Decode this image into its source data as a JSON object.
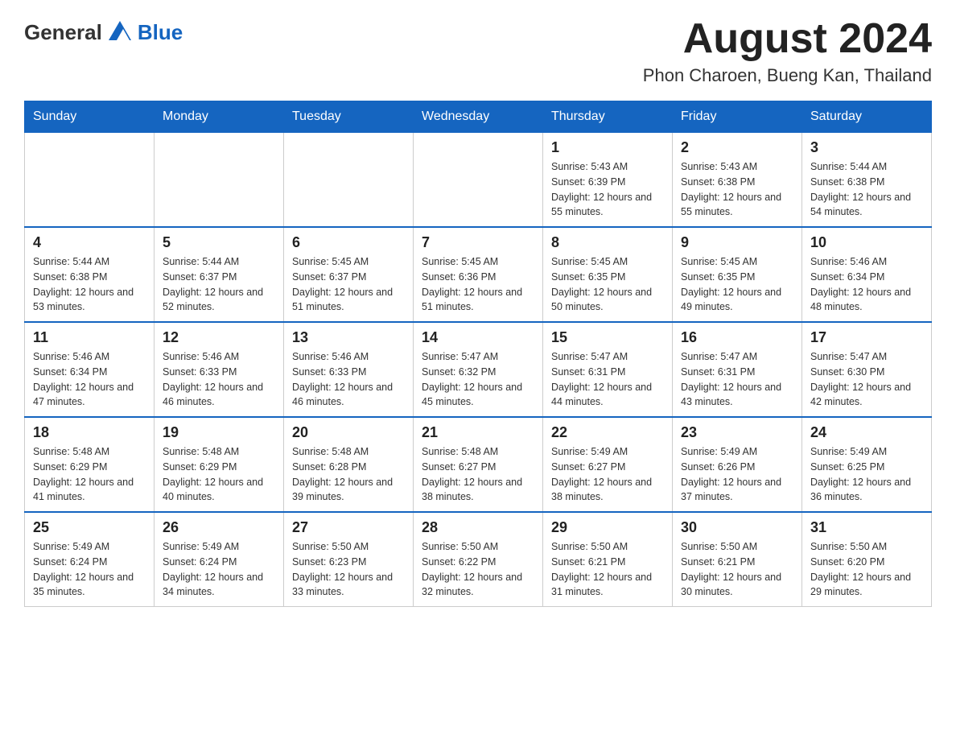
{
  "header": {
    "logo_general": "General",
    "logo_blue": "Blue",
    "month_title": "August 2024",
    "location": "Phon Charoen, Bueng Kan, Thailand"
  },
  "weekdays": [
    "Sunday",
    "Monday",
    "Tuesday",
    "Wednesday",
    "Thursday",
    "Friday",
    "Saturday"
  ],
  "weeks": [
    [
      {
        "day": "",
        "info": ""
      },
      {
        "day": "",
        "info": ""
      },
      {
        "day": "",
        "info": ""
      },
      {
        "day": "",
        "info": ""
      },
      {
        "day": "1",
        "info": "Sunrise: 5:43 AM\nSunset: 6:39 PM\nDaylight: 12 hours and 55 minutes."
      },
      {
        "day": "2",
        "info": "Sunrise: 5:43 AM\nSunset: 6:38 PM\nDaylight: 12 hours and 55 minutes."
      },
      {
        "day": "3",
        "info": "Sunrise: 5:44 AM\nSunset: 6:38 PM\nDaylight: 12 hours and 54 minutes."
      }
    ],
    [
      {
        "day": "4",
        "info": "Sunrise: 5:44 AM\nSunset: 6:38 PM\nDaylight: 12 hours and 53 minutes."
      },
      {
        "day": "5",
        "info": "Sunrise: 5:44 AM\nSunset: 6:37 PM\nDaylight: 12 hours and 52 minutes."
      },
      {
        "day": "6",
        "info": "Sunrise: 5:45 AM\nSunset: 6:37 PM\nDaylight: 12 hours and 51 minutes."
      },
      {
        "day": "7",
        "info": "Sunrise: 5:45 AM\nSunset: 6:36 PM\nDaylight: 12 hours and 51 minutes."
      },
      {
        "day": "8",
        "info": "Sunrise: 5:45 AM\nSunset: 6:35 PM\nDaylight: 12 hours and 50 minutes."
      },
      {
        "day": "9",
        "info": "Sunrise: 5:45 AM\nSunset: 6:35 PM\nDaylight: 12 hours and 49 minutes."
      },
      {
        "day": "10",
        "info": "Sunrise: 5:46 AM\nSunset: 6:34 PM\nDaylight: 12 hours and 48 minutes."
      }
    ],
    [
      {
        "day": "11",
        "info": "Sunrise: 5:46 AM\nSunset: 6:34 PM\nDaylight: 12 hours and 47 minutes."
      },
      {
        "day": "12",
        "info": "Sunrise: 5:46 AM\nSunset: 6:33 PM\nDaylight: 12 hours and 46 minutes."
      },
      {
        "day": "13",
        "info": "Sunrise: 5:46 AM\nSunset: 6:33 PM\nDaylight: 12 hours and 46 minutes."
      },
      {
        "day": "14",
        "info": "Sunrise: 5:47 AM\nSunset: 6:32 PM\nDaylight: 12 hours and 45 minutes."
      },
      {
        "day": "15",
        "info": "Sunrise: 5:47 AM\nSunset: 6:31 PM\nDaylight: 12 hours and 44 minutes."
      },
      {
        "day": "16",
        "info": "Sunrise: 5:47 AM\nSunset: 6:31 PM\nDaylight: 12 hours and 43 minutes."
      },
      {
        "day": "17",
        "info": "Sunrise: 5:47 AM\nSunset: 6:30 PM\nDaylight: 12 hours and 42 minutes."
      }
    ],
    [
      {
        "day": "18",
        "info": "Sunrise: 5:48 AM\nSunset: 6:29 PM\nDaylight: 12 hours and 41 minutes."
      },
      {
        "day": "19",
        "info": "Sunrise: 5:48 AM\nSunset: 6:29 PM\nDaylight: 12 hours and 40 minutes."
      },
      {
        "day": "20",
        "info": "Sunrise: 5:48 AM\nSunset: 6:28 PM\nDaylight: 12 hours and 39 minutes."
      },
      {
        "day": "21",
        "info": "Sunrise: 5:48 AM\nSunset: 6:27 PM\nDaylight: 12 hours and 38 minutes."
      },
      {
        "day": "22",
        "info": "Sunrise: 5:49 AM\nSunset: 6:27 PM\nDaylight: 12 hours and 38 minutes."
      },
      {
        "day": "23",
        "info": "Sunrise: 5:49 AM\nSunset: 6:26 PM\nDaylight: 12 hours and 37 minutes."
      },
      {
        "day": "24",
        "info": "Sunrise: 5:49 AM\nSunset: 6:25 PM\nDaylight: 12 hours and 36 minutes."
      }
    ],
    [
      {
        "day": "25",
        "info": "Sunrise: 5:49 AM\nSunset: 6:24 PM\nDaylight: 12 hours and 35 minutes."
      },
      {
        "day": "26",
        "info": "Sunrise: 5:49 AM\nSunset: 6:24 PM\nDaylight: 12 hours and 34 minutes."
      },
      {
        "day": "27",
        "info": "Sunrise: 5:50 AM\nSunset: 6:23 PM\nDaylight: 12 hours and 33 minutes."
      },
      {
        "day": "28",
        "info": "Sunrise: 5:50 AM\nSunset: 6:22 PM\nDaylight: 12 hours and 32 minutes."
      },
      {
        "day": "29",
        "info": "Sunrise: 5:50 AM\nSunset: 6:21 PM\nDaylight: 12 hours and 31 minutes."
      },
      {
        "day": "30",
        "info": "Sunrise: 5:50 AM\nSunset: 6:21 PM\nDaylight: 12 hours and 30 minutes."
      },
      {
        "day": "31",
        "info": "Sunrise: 5:50 AM\nSunset: 6:20 PM\nDaylight: 12 hours and 29 minutes."
      }
    ]
  ]
}
